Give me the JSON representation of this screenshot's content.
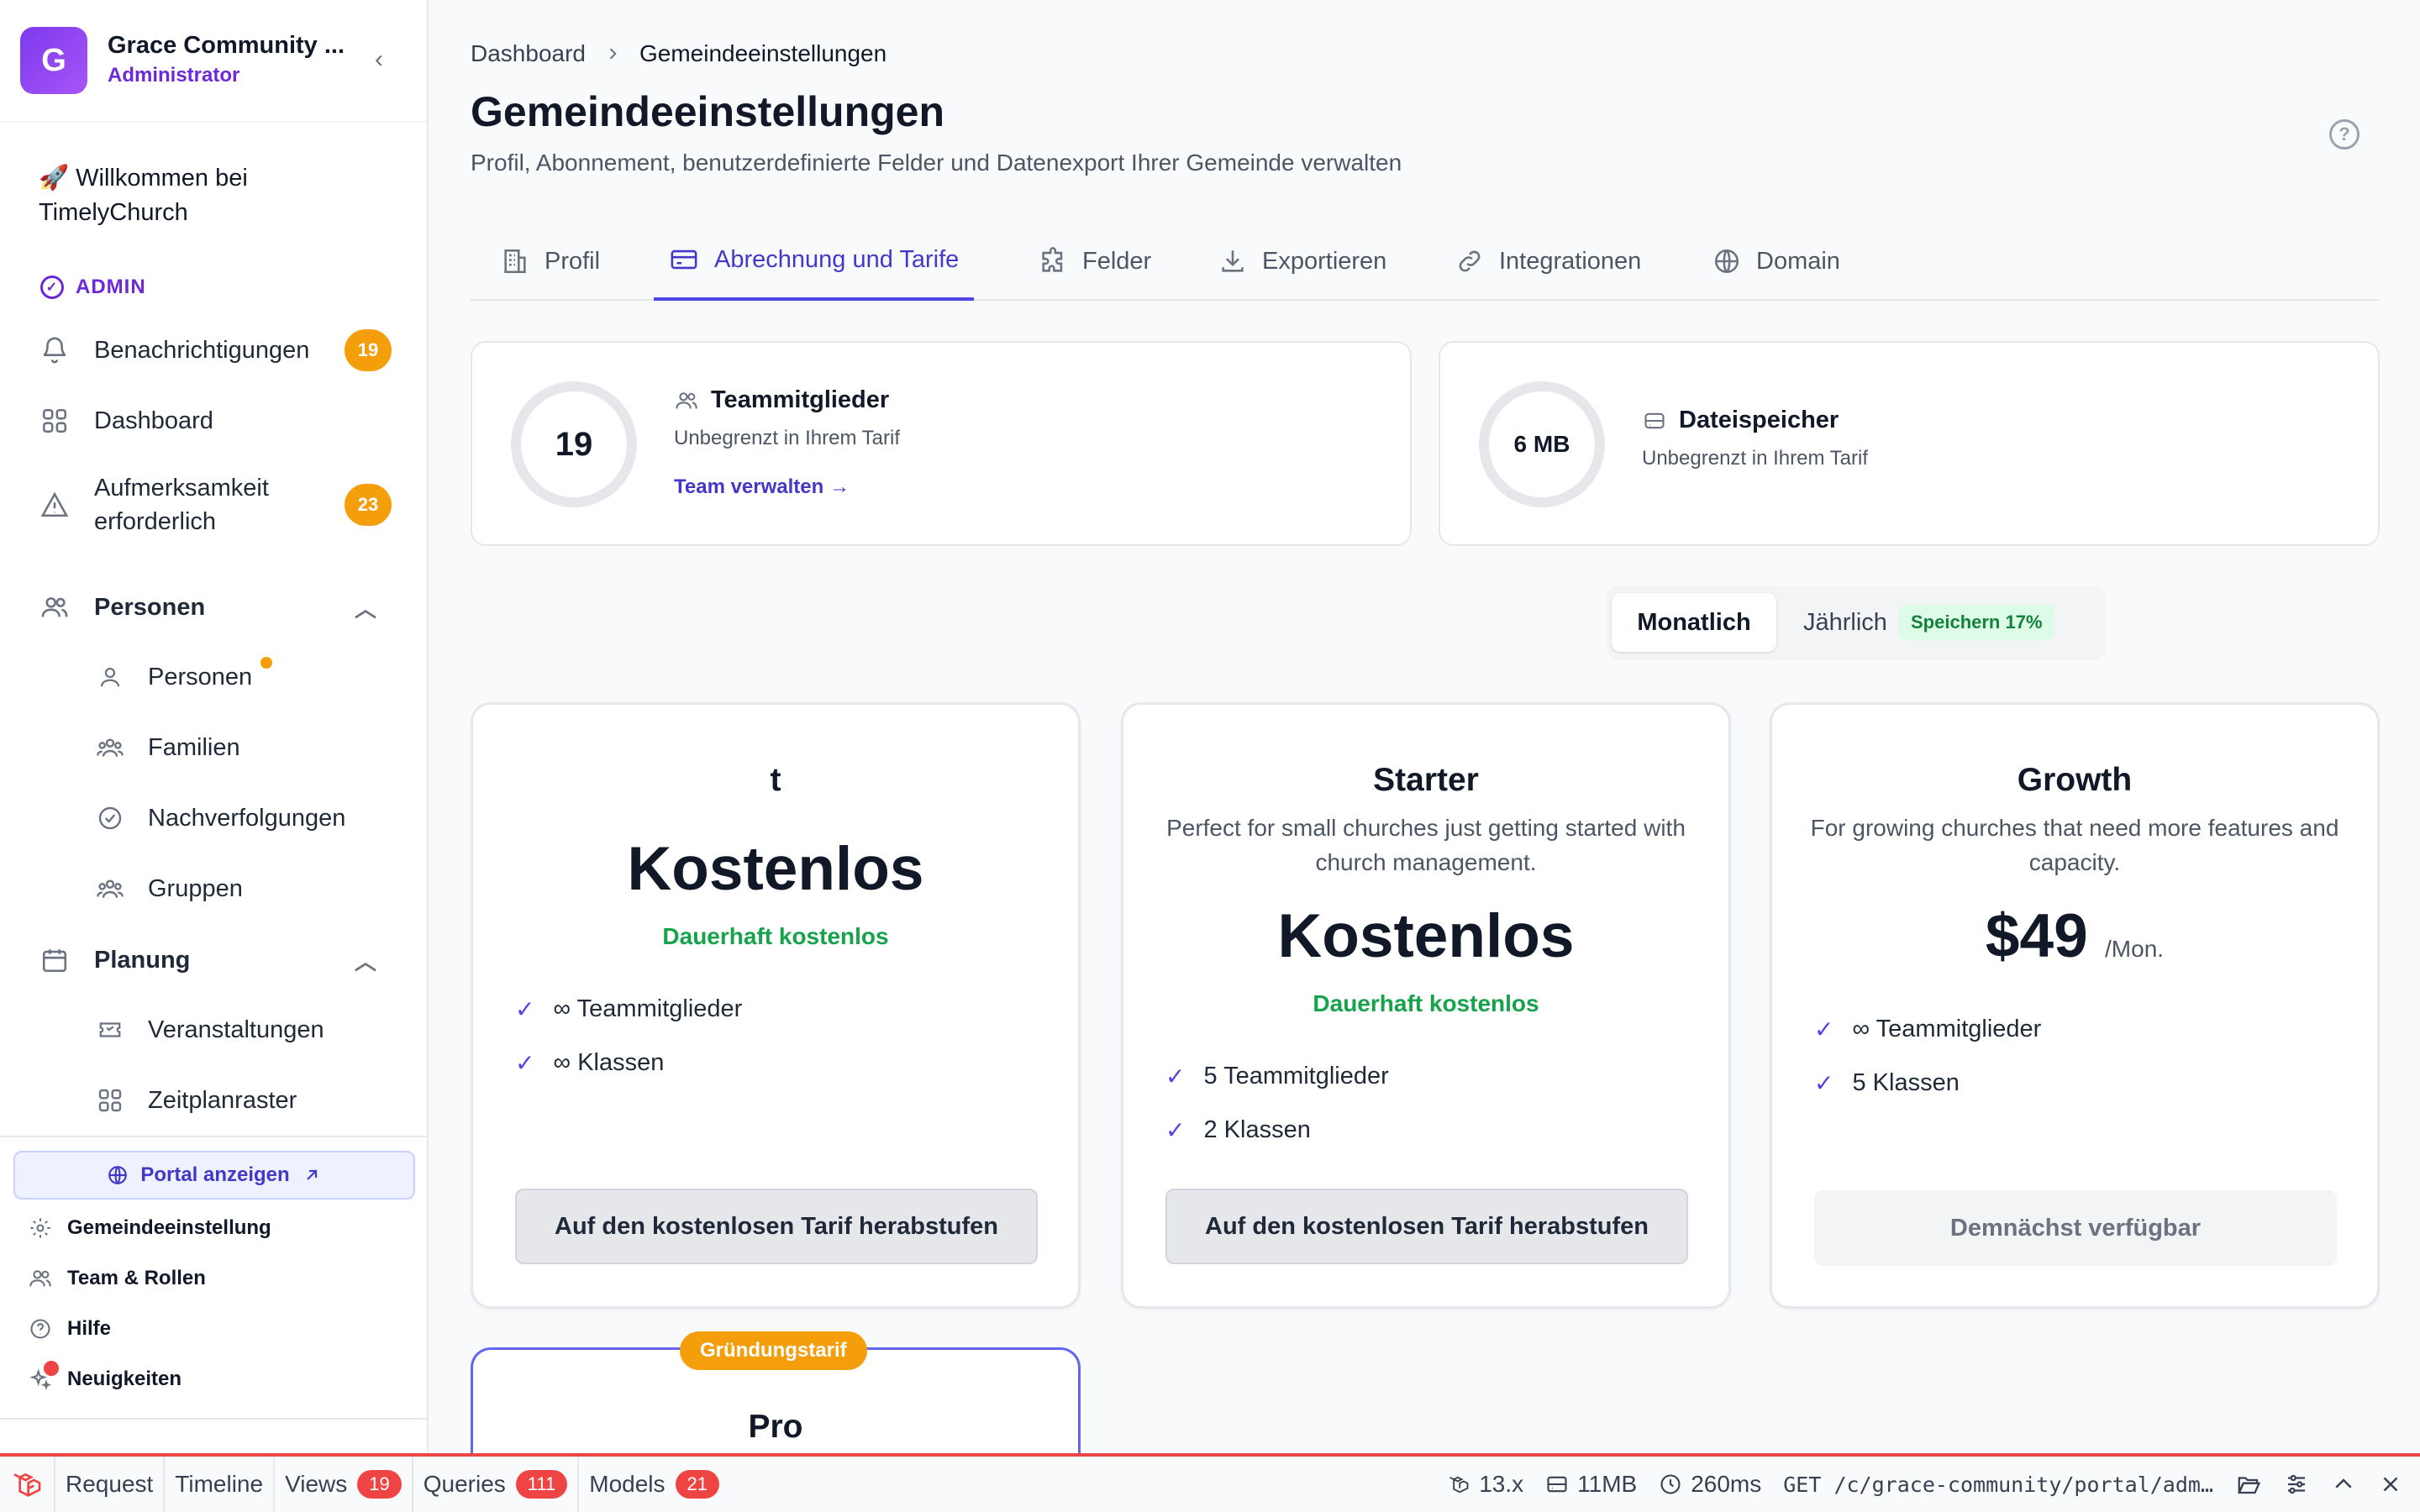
{
  "sidebar": {
    "org_initial": "G",
    "org_name": "Grace Community ...",
    "org_role": "Administrator",
    "welcome": "🚀 Willkommen bei TimelyChurch",
    "admin_label": "ADMIN",
    "items": [
      {
        "label": "Benachrichtigungen",
        "badge": "19"
      },
      {
        "label": "Dashboard"
      },
      {
        "label": "Aufmerksamkeit erforderlich",
        "badge": "23"
      }
    ],
    "section_people": "Personen",
    "people_items": [
      "Personen",
      "Familien",
      "Nachverfolgungen",
      "Gruppen"
    ],
    "section_planning": "Planung",
    "planning_items": [
      "Veranstaltungen",
      "Zeitplanraster"
    ],
    "portal_button": "Portal anzeigen",
    "footer_items": [
      "Gemeindeeinstellung",
      "Team & Rollen",
      "Hilfe",
      "Neuigkeiten"
    ]
  },
  "header": {
    "breadcrumb_root": "Dashboard",
    "breadcrumb_current": "Gemeindeeinstellungen",
    "title": "Gemeindeeinstellungen",
    "subtitle": "Profil, Abonnement, benutzerdefinierte Felder und Datenexport Ihrer Gemeinde verwalten"
  },
  "tabs": [
    "Profil",
    "Abrechnung und Tarife",
    "Felder",
    "Exportieren",
    "Integrationen",
    "Domain"
  ],
  "active_tab": "Abrechnung und Tarife",
  "stats": {
    "team": {
      "value": "19",
      "title": "Teammitglieder",
      "sub": "Unbegrenzt in Ihrem Tarif",
      "link": "Team verwalten →"
    },
    "storage": {
      "value": "6 MB",
      "title": "Dateispeicher",
      "sub": "Unbegrenzt in Ihrem Tarif"
    }
  },
  "billing_toggle": {
    "monthly": "Monatlich",
    "yearly": "Jährlich",
    "save": "Speichern 17%"
  },
  "plans": [
    {
      "name": "t",
      "price": "Kostenlos",
      "note": "Dauerhaft kostenlos",
      "features": [
        "∞ Teammitglieder",
        "∞ Klassen"
      ],
      "button": "Auf den kostenlosen Tarif herabstufen"
    },
    {
      "name": "Starter",
      "desc": "Perfect for small churches just getting started with church management.",
      "price": "Kostenlos",
      "note": "Dauerhaft kostenlos",
      "features": [
        "5 Teammitglieder",
        "2 Klassen"
      ],
      "button": "Auf den kostenlosen Tarif herabstufen"
    },
    {
      "name": "Growth",
      "desc": "For growing churches that need more features and capacity.",
      "price": "$49",
      "per": "/Mon.",
      "features": [
        "∞ Teammitglieder",
        "5 Klassen"
      ],
      "button": "Demnächst verfügbar"
    },
    {
      "name": "Pro",
      "ribbon": "Gründungstarif"
    }
  ],
  "devbar": {
    "tabs": [
      {
        "label": "Request"
      },
      {
        "label": "Timeline"
      },
      {
        "label": "Views",
        "badge": "19"
      },
      {
        "label": "Queries",
        "badge": "111"
      },
      {
        "label": "Models",
        "badge": "21"
      }
    ],
    "version": "13.x",
    "memory": "11MB",
    "time": "260ms",
    "request": "GET /c/grace-community/portal/adm…"
  },
  "colors": {
    "accent": "#4f46e5",
    "warning": "#f59e0b",
    "success": "#16a34a",
    "danger": "#ef4444"
  }
}
